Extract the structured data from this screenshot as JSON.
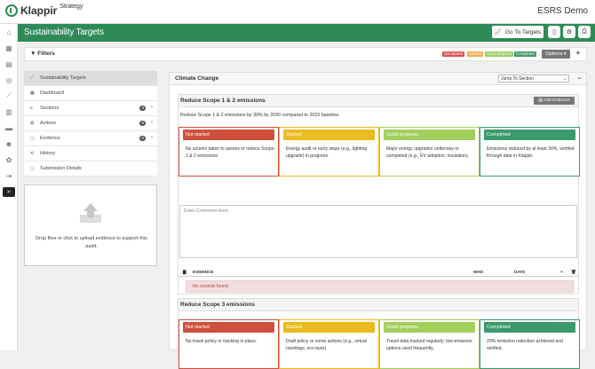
{
  "app": {
    "logo_text": "Klappir",
    "logo_sub": "Strategy",
    "org_name": "ESRS Demo"
  },
  "header": {
    "title": "Sustainability Targets",
    "targets_button": "Go To Targets"
  },
  "filters": {
    "label": "Filters",
    "badges": [
      {
        "label": "Not started",
        "color": "#d9534f"
      },
      {
        "label": "Started",
        "color": "#f0ad4e"
      },
      {
        "label": "Good progress",
        "color": "#9ccc65"
      },
      {
        "label": "Completed",
        "color": "#3a9a6a"
      }
    ],
    "options_label": "Options",
    "add_label": "+"
  },
  "nav": {
    "items": [
      {
        "label": "Sustainability Targets",
        "active": true,
        "icon": "chart-icon"
      },
      {
        "label": "Dashboard",
        "icon": "dashboard-icon"
      },
      {
        "label": "Sections",
        "count": "3",
        "icon": "list-icon"
      },
      {
        "label": "Actions",
        "count": "6",
        "icon": "gear-icon"
      },
      {
        "label": "Evidence",
        "count": "0",
        "icon": "info-icon"
      },
      {
        "label": "History",
        "icon": "history-icon"
      },
      {
        "label": "Submission Details",
        "icon": "info-circle-icon"
      }
    ]
  },
  "upload": {
    "text": "Drop files or click to upload evidence to support this audit."
  },
  "section": {
    "title": "Climate Change",
    "jump_label": "Jump To Section"
  },
  "cards": [
    {
      "title": "Reduce Scope 1 & 2 emissions",
      "add_evidence": "Add Evidence",
      "description": "Reduce Scope 1 & 2 emissions by 30% by 2030 compared to 2023 baseline.",
      "statuses": [
        {
          "label": "Not started",
          "desc": "No actions taken to assess or reduce Scope 1 & 2 emissions.",
          "color": "#cf4f3c"
        },
        {
          "label": "Started",
          "desc": "Energy audit or early steps (e.g., lighting upgrade) in progress.",
          "color": "#eabb1e"
        },
        {
          "label": "Good progress",
          "desc": "Major energy upgrades underway or completed (e.g., EV adoption, insulation).",
          "color": "#a2cf5a"
        },
        {
          "label": "Completed",
          "desc": "Emissions reduced by at least 30%, verified through data in Klappir.",
          "color": "#3a9a6a"
        }
      ],
      "comment_placeholder": "Enter Comment Here",
      "table": {
        "columns": [
          "EVIDENCE",
          "WHO",
          "DATE"
        ],
        "empty": "No records found."
      }
    },
    {
      "title": "Reduce Scope 3 emissions",
      "statuses": [
        {
          "label": "Not started",
          "desc": "No travel policy or tracking in place.",
          "color": "#cf4f3c"
        },
        {
          "label": "Started",
          "desc": "Draft policy or some actions (e.g., virtual meetings, eco taxis)",
          "color": "#eabb1e"
        },
        {
          "label": "Good progress",
          "desc": "Travel data tracked regularly; low-emission options used frequently.",
          "color": "#a2cf5a"
        },
        {
          "label": "Completed",
          "desc": "20% emission reduction achieved and verified.",
          "color": "#3a9a6a"
        }
      ]
    }
  ]
}
